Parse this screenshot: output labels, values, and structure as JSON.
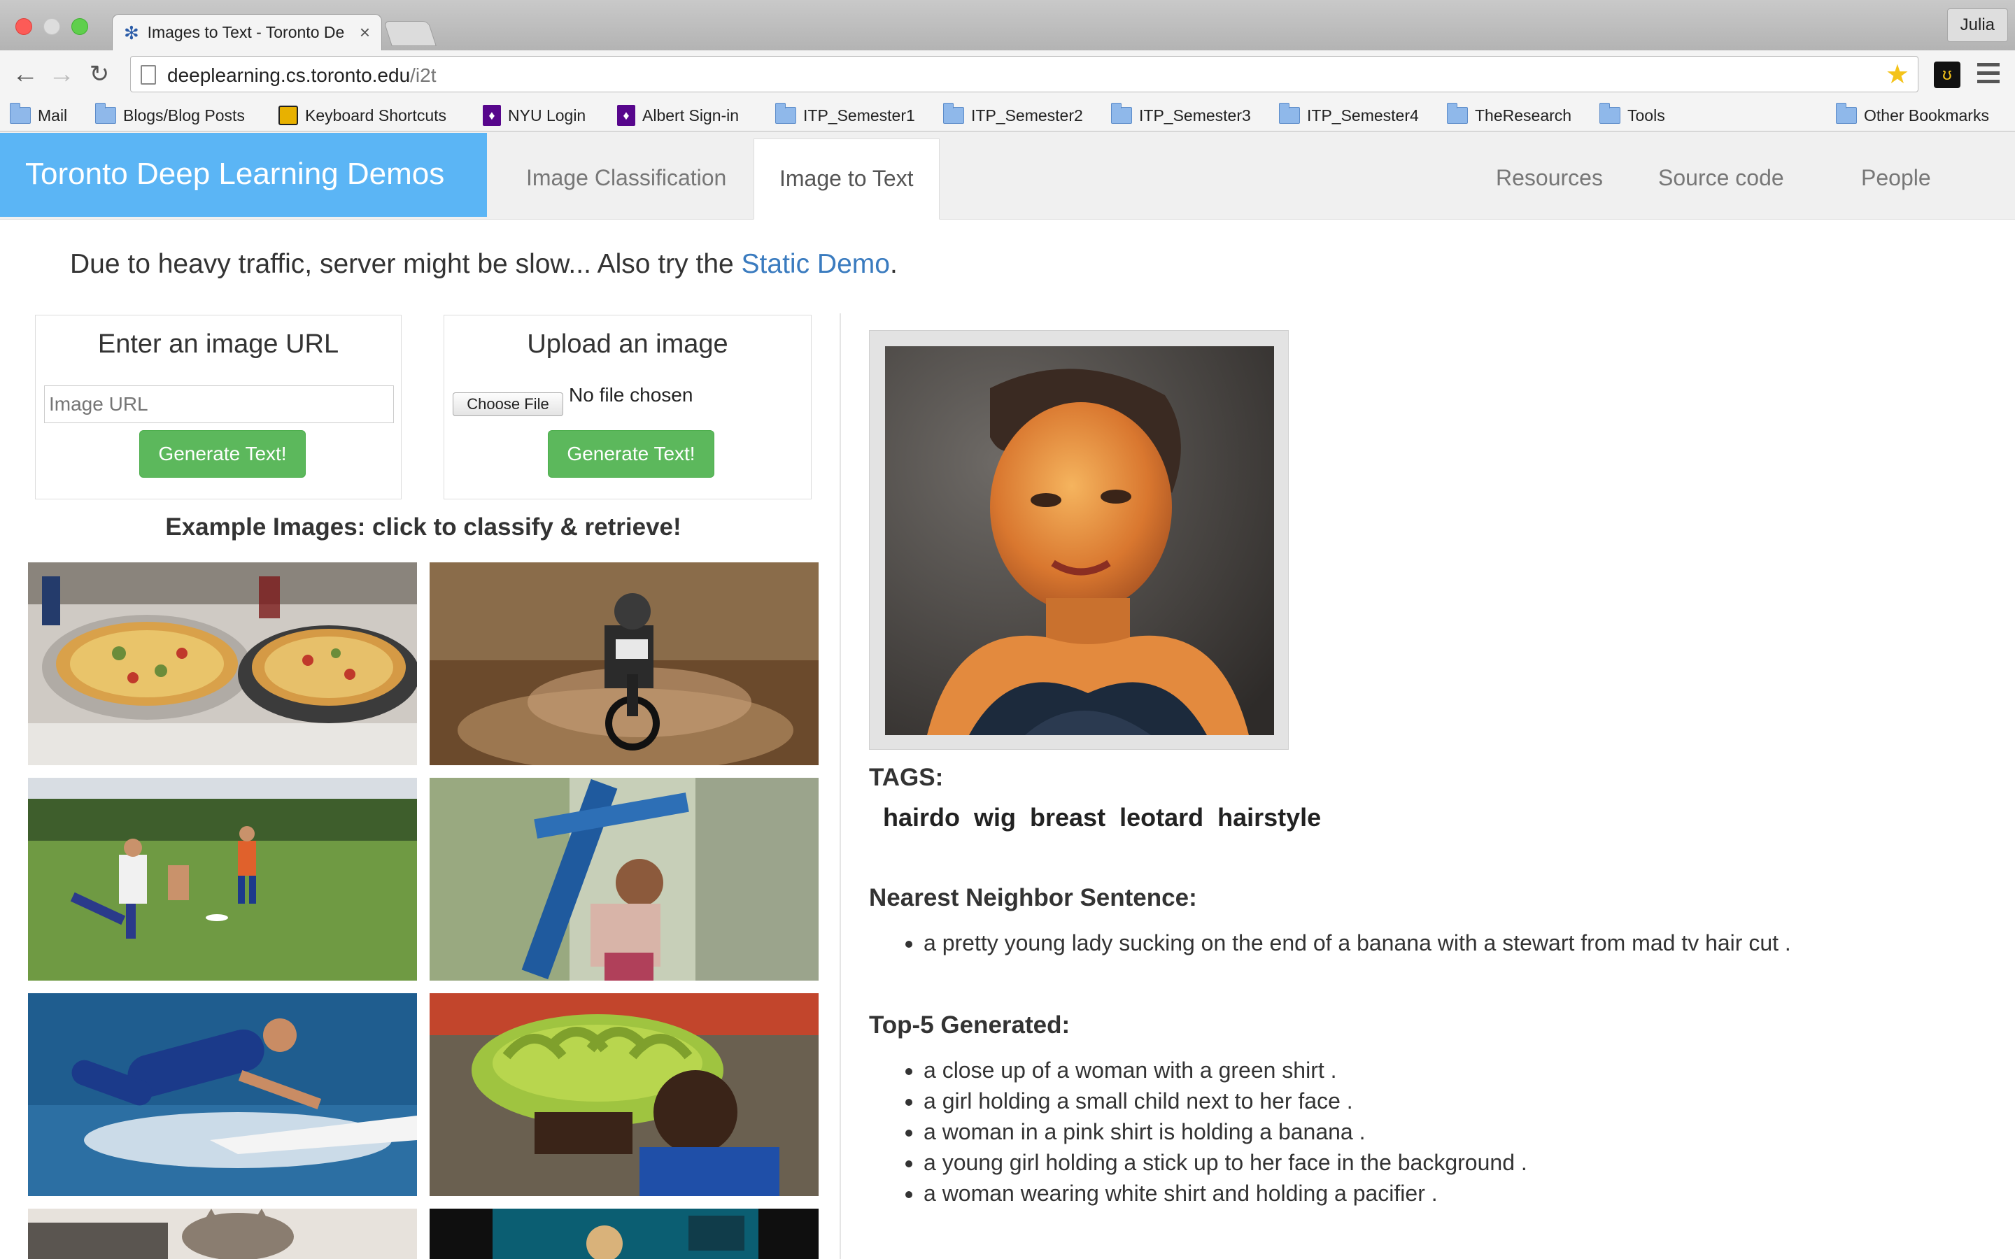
{
  "browser": {
    "tab_title": "Images to Text - Toronto De",
    "profile_name": "Julia",
    "url_host": "deeplearning.cs.toronto.edu",
    "url_path": "/i2t",
    "bookmarks": [
      "Mail",
      "Blogs/Blog Posts",
      "Keyboard Shortcuts",
      "NYU Login",
      "Albert Sign-in",
      "ITP_Semester1",
      "ITP_Semester2",
      "ITP_Semester3",
      "ITP_Semester4",
      "TheResearch",
      "Tools"
    ],
    "other_bookmarks": "Other Bookmarks"
  },
  "site": {
    "brand": "Toronto Deep Learning Demos",
    "nav_left": [
      "Image Classification",
      "Image to Text"
    ],
    "nav_right": [
      "Resources",
      "Source code",
      "People"
    ],
    "active_nav": "Image to Text"
  },
  "notice": {
    "text": "Due to heavy traffic, server might be slow... Also try the ",
    "link": "Static Demo",
    "end": "."
  },
  "url_panel": {
    "title": "Enter an image URL",
    "placeholder": "Image URL",
    "button": "Generate Text!"
  },
  "upload_panel": {
    "title": "Upload an image",
    "choose_label": "Choose File",
    "no_file": "No file chosen",
    "button": "Generate Text!"
  },
  "examples": {
    "title": "Example Images: click to classify & retrieve!",
    "images": [
      "pizzas-on-stove",
      "motocross-rider",
      "frisbee-players",
      "girl-on-pole",
      "surfer",
      "man-with-bananas",
      "cat-on-laptop",
      "woman-on-tv"
    ]
  },
  "result": {
    "tags_label": "TAGS:",
    "tags": [
      "hairdo",
      "wig",
      "breast",
      "leotard",
      "hairstyle"
    ],
    "nn_label": "Nearest Neighbor Sentence:",
    "nn_sentences": [
      "a pretty young lady sucking on the end of a banana with a stewart from mad tv hair cut ."
    ],
    "gen_label": "Top-5 Generated:",
    "generated": [
      "a close up of a woman with a green shirt .",
      "a girl holding a small child next to her face .",
      "a woman in a pink shirt is holding a banana .",
      "a young girl holding a stick up to her face in the background .",
      "a woman wearing white shirt and holding a pacifier ."
    ]
  },
  "colors": {
    "brand_bg": "#5bb5f5",
    "button_green": "#5cb85c",
    "link_blue": "#3a7bbf"
  }
}
